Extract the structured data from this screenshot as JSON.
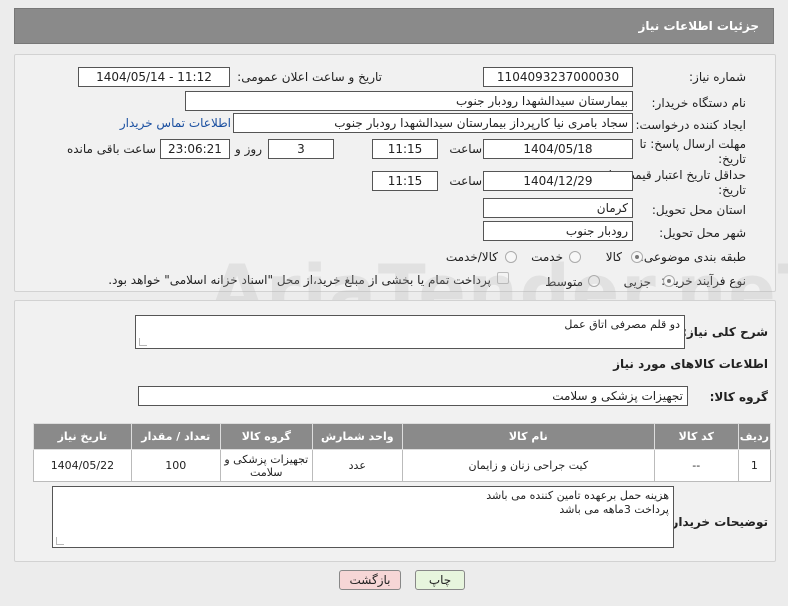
{
  "header": {
    "title": "جزئیات اطلاعات نیاز"
  },
  "form": {
    "need_number_label": "شماره نیاز:",
    "need_number": "1104093237000030",
    "announce_label": "تاریخ و ساعت اعلان عمومی:",
    "announce_value": "1404/05/14 - 11:12",
    "buyer_org_label": "نام دستگاه خریدار:",
    "buyer_org": "بیمارستان سیدالشهدا رودبار جنوب",
    "creator_label": "ایجاد کننده درخواست:",
    "creator": "سجاد بامری نیا کارپرداز بیمارستان سیدالشهدا رودبار جنوب",
    "contact_link": "اطلاعات تماس خریدار",
    "deadline_label": "مهلت ارسال پاسخ: تا تاریخ:",
    "deadline_date": "1404/05/18",
    "time_label": "ساعت",
    "deadline_time": "11:15",
    "day_label": "روز و",
    "days_value": "3",
    "remaining_time": "23:06:21",
    "remaining_label": "ساعت باقی مانده",
    "validity_label": "حداقل تاریخ اعتبار قیمت: تا تاریخ:",
    "validity_date": "1404/12/29",
    "validity_time": "11:15",
    "province_label": "استان محل تحویل:",
    "province": "کرمان",
    "city_label": "شهر محل تحویل:",
    "city": "رودبار جنوب",
    "category_label": "طبقه بندی موضوعی:",
    "category_options": [
      "کالا",
      "خدمت",
      "کالا/خدمت"
    ],
    "process_label": "نوع فرآیند خرید :",
    "process_options": [
      "جزیی",
      "متوسط"
    ],
    "payment_note": "پرداخت تمام یا بخشی از مبلغ خرید،از محل \"اسناد خزانه اسلامی\" خواهد بود."
  },
  "description": {
    "label": "شرح کلی نیاز:",
    "value": "دو قلم مصرفی اتاق عمل"
  },
  "goods": {
    "section_title": "اطلاعات کالاهای مورد نیاز",
    "group_label": "گروه کالا:",
    "group_value": "تجهیزات پزشکی و سلامت",
    "columns": [
      "ردیف",
      "کد کالا",
      "نام کالا",
      "واحد شمارش",
      "گروه کالا",
      "تعداد / مقدار",
      "تاریخ نیاز"
    ],
    "rows": [
      [
        "1",
        "--",
        "کیت جراحی زنان و زایمان",
        "عدد",
        "تجهیزات پزشکی و سلامت",
        "100",
        "1404/05/22"
      ]
    ]
  },
  "buyer_notes": {
    "label": "توضیحات خریدار:",
    "line1": "هزینه حمل برعهده تامین کننده می باشد",
    "line2": "پرداخت 3ماهه می باشد"
  },
  "buttons": {
    "print": "چاپ",
    "back": "بازگشت"
  },
  "colors": {
    "header": "#8a8a8a",
    "link": "#1a4fa0",
    "back_button": "#f6d6d6",
    "print_button": "#e7f5dd"
  }
}
